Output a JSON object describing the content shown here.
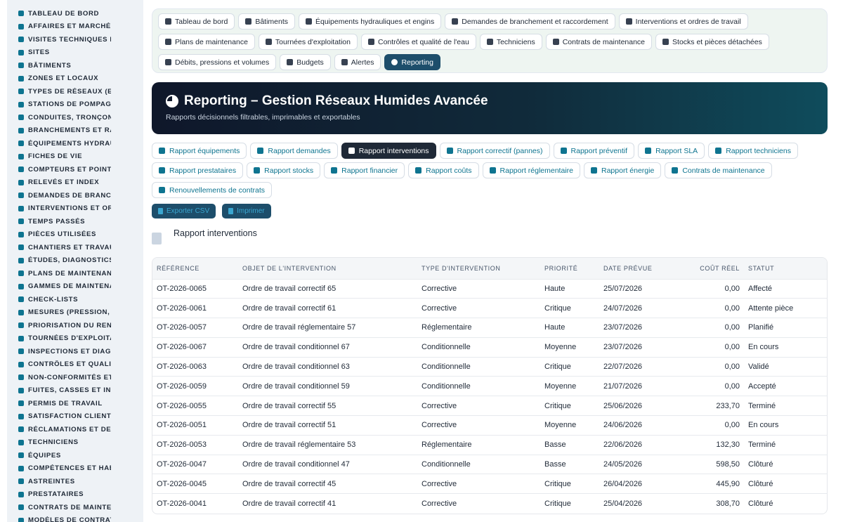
{
  "sidebar": {
    "items": [
      {
        "label": "TABLEAU DE BORD",
        "icon": "gauge-icon"
      },
      {
        "label": "AFFAIRES ET MARCHÉS",
        "icon": "target-icon"
      },
      {
        "label": "VISITES TECHNIQUES ET",
        "icon": "clipboard-icon"
      },
      {
        "label": "SITES",
        "icon": "map-pin-icon"
      },
      {
        "label": "BÂTIMENTS",
        "icon": "building-icon"
      },
      {
        "label": "ZONES ET LOCAUX",
        "icon": "layers-icon"
      },
      {
        "label": "TYPES DE RÉSEAUX (EAU",
        "icon": "network-icon"
      },
      {
        "label": "STATIONS DE POMPAGE I",
        "icon": "station-icon"
      },
      {
        "label": "CONDUITES, TRONÇONS",
        "icon": "pipe-icon"
      },
      {
        "label": "BRANCHEMENTS ET RAC",
        "icon": "branch-icon"
      },
      {
        "label": "ÉQUIPEMENTS HYDRAUL",
        "icon": "gears-icon"
      },
      {
        "label": "FICHES DE VIE",
        "icon": "file-icon"
      },
      {
        "label": "COMPTEURS ET POINTS I",
        "icon": "meter-icon"
      },
      {
        "label": "RELEVÉS ET INDEX",
        "icon": "list-icon"
      },
      {
        "label": "DEMANDES DE BRANCHE",
        "icon": "question-icon"
      },
      {
        "label": "INTERVENTIONS ET ORDI",
        "icon": "clipboard-check-icon"
      },
      {
        "label": "TEMPS PASSÉS",
        "icon": "clock-icon"
      },
      {
        "label": "PIÈCES UTILISÉES",
        "icon": "box-icon"
      },
      {
        "label": "CHANTIERS ET TRAVAUX",
        "icon": "hammer-icon"
      },
      {
        "label": "ÉTUDES, DIAGNOSTICS E",
        "icon": "search-icon"
      },
      {
        "label": "PLANS DE MAINTENANCE",
        "icon": "calendar-icon"
      },
      {
        "label": "GAMMES DE MAINTENAN",
        "icon": "list-check-icon"
      },
      {
        "label": "CHECK-LISTS",
        "icon": "checklist-icon"
      },
      {
        "label": "MESURES (PRESSION, DÉ",
        "icon": "ruler-icon"
      },
      {
        "label": "PRIORISATION DU RENOU",
        "icon": "sort-icon"
      },
      {
        "label": "TOURNÉES D'EXPLOITATI",
        "icon": "route-icon"
      },
      {
        "label": "INSPECTIONS ET DIAGNC",
        "icon": "magnifier-icon"
      },
      {
        "label": "CONTRÔLES ET QUALITÉ",
        "icon": "flask-icon"
      },
      {
        "label": "NON-CONFORMITÉS ET A",
        "icon": "alert-icon"
      },
      {
        "label": "FUITES, CASSES ET INCI",
        "icon": "warning-icon"
      },
      {
        "label": "PERMIS DE TRAVAIL",
        "icon": "permit-icon"
      },
      {
        "label": "SATISFACTION CLIENT",
        "icon": "smile-icon"
      },
      {
        "label": "RÉCLAMATIONS ET DEMA",
        "icon": "comment-icon"
      },
      {
        "label": "TECHNICIENS",
        "icon": "helmet-icon"
      },
      {
        "label": "ÉQUIPES",
        "icon": "users-icon"
      },
      {
        "label": "COMPÉTENCES ET HABIL",
        "icon": "graduation-icon"
      },
      {
        "label": "ASTREINTES",
        "icon": "phone-icon"
      },
      {
        "label": "PRESTATAIRES",
        "icon": "handshake-icon"
      },
      {
        "label": "CONTRATS DE MAINTENA",
        "icon": "contract-icon"
      },
      {
        "label": "MODÈLES DE CONTRATS",
        "icon": "template-icon"
      }
    ]
  },
  "topnav": {
    "items": [
      {
        "label": "Tableau de bord",
        "icon": "gauge-icon",
        "active": false
      },
      {
        "label": "Bâtiments",
        "icon": "building-icon",
        "active": false
      },
      {
        "label": "Équipements hydrauliques et engins",
        "icon": "gears-icon",
        "active": false
      },
      {
        "label": "Demandes de branchement et raccordement",
        "icon": "question-icon",
        "active": false
      },
      {
        "label": "Interventions et ordres de travail",
        "icon": "clipboard-check-icon",
        "active": false
      },
      {
        "label": "Plans de maintenance",
        "icon": "calendar-icon",
        "active": false
      },
      {
        "label": "Tournées d'exploitation",
        "icon": "route-icon",
        "active": false
      },
      {
        "label": "Contrôles et qualité de l'eau",
        "icon": "flask-icon",
        "active": false
      },
      {
        "label": "Techniciens",
        "icon": "helmet-icon",
        "active": false
      },
      {
        "label": "Contrats de maintenance",
        "icon": "contract-icon",
        "active": false
      },
      {
        "label": "Stocks et pièces détachées",
        "icon": "network-icon",
        "active": false
      },
      {
        "label": "Débits, pressions et volumes",
        "icon": "bolt-icon",
        "active": false
      },
      {
        "label": "Budgets",
        "icon": "money-icon",
        "active": false
      },
      {
        "label": "Alertes",
        "icon": "bell-icon",
        "active": false
      },
      {
        "label": "Reporting",
        "icon": "pie-chart-icon",
        "active": true
      }
    ]
  },
  "hero": {
    "title": "Reporting – Gestion Réseaux Humides Avancée",
    "subtitle": "Rapports décisionnels filtrables, imprimables et exportables"
  },
  "reports": {
    "items": [
      {
        "label": "Rapport équipements",
        "icon": "gears-icon",
        "active": false
      },
      {
        "label": "Rapport demandes",
        "icon": "question-icon",
        "active": false
      },
      {
        "label": "Rapport interventions",
        "icon": "clipboard-check-icon",
        "active": true
      },
      {
        "label": "Rapport correctif (pannes)",
        "icon": "tools-icon",
        "active": false
      },
      {
        "label": "Rapport préventif",
        "icon": "calendar-icon",
        "active": false
      },
      {
        "label": "Rapport SLA",
        "icon": "stopwatch-icon",
        "active": false
      },
      {
        "label": "Rapport techniciens",
        "icon": "helmet-icon",
        "active": false
      },
      {
        "label": "Rapport prestataires",
        "icon": "handshake-icon",
        "active": false
      },
      {
        "label": "Rapport stocks",
        "icon": "network-icon",
        "active": false
      },
      {
        "label": "Rapport financier",
        "icon": "money-icon",
        "active": false
      },
      {
        "label": "Rapport coûts",
        "icon": "coins-icon",
        "active": false
      },
      {
        "label": "Rapport réglementaire",
        "icon": "clipboard-check-icon",
        "active": false
      },
      {
        "label": "Rapport énergie",
        "icon": "bolt-icon",
        "active": false
      },
      {
        "label": "Contrats de maintenance",
        "icon": "contract-icon",
        "active": false
      },
      {
        "label": "Renouvellements de contrats",
        "icon": "refresh-icon",
        "active": false
      }
    ]
  },
  "actions": {
    "export_label": "Exporter CSV",
    "print_label": "Imprimer"
  },
  "report": {
    "title": "Rapport interventions"
  },
  "table": {
    "headers": [
      "Référence",
      "Objet de l'intervention",
      "Type d'intervention",
      "Priorité",
      "Date prévue",
      "Coût réel",
      "Statut"
    ],
    "rows": [
      [
        "OT-2026-0065",
        "Ordre de travail correctif 65",
        "Corrective",
        "Haute",
        "25/07/2026",
        "0,00",
        "Affecté"
      ],
      [
        "OT-2026-0061",
        "Ordre de travail correctif 61",
        "Corrective",
        "Critique",
        "24/07/2026",
        "0,00",
        "Attente pièce"
      ],
      [
        "OT-2026-0057",
        "Ordre de travail réglementaire 57",
        "Réglementaire",
        "Haute",
        "23/07/2026",
        "0,00",
        "Planifié"
      ],
      [
        "OT-2026-0067",
        "Ordre de travail conditionnel 67",
        "Conditionnelle",
        "Moyenne",
        "23/07/2026",
        "0,00",
        "En cours"
      ],
      [
        "OT-2026-0063",
        "Ordre de travail conditionnel 63",
        "Conditionnelle",
        "Critique",
        "22/07/2026",
        "0,00",
        "Validé"
      ],
      [
        "OT-2026-0059",
        "Ordre de travail conditionnel 59",
        "Conditionnelle",
        "Moyenne",
        "21/07/2026",
        "0,00",
        "Accepté"
      ],
      [
        "OT-2026-0055",
        "Ordre de travail correctif 55",
        "Corrective",
        "Critique",
        "25/06/2026",
        "233,70",
        "Terminé"
      ],
      [
        "OT-2026-0051",
        "Ordre de travail correctif 51",
        "Corrective",
        "Moyenne",
        "24/06/2026",
        "0,00",
        "En cours"
      ],
      [
        "OT-2026-0053",
        "Ordre de travail réglementaire 53",
        "Réglementaire",
        "Basse",
        "22/06/2026",
        "132,30",
        "Terminé"
      ],
      [
        "OT-2026-0047",
        "Ordre de travail conditionnel 47",
        "Conditionnelle",
        "Basse",
        "24/05/2026",
        "598,50",
        "Clôturé"
      ],
      [
        "OT-2026-0045",
        "Ordre de travail correctif 45",
        "Corrective",
        "Critique",
        "26/04/2026",
        "445,90",
        "Clôturé"
      ],
      [
        "OT-2026-0041",
        "Ordre de travail correctif 41",
        "Corrective",
        "Critique",
        "25/04/2026",
        "308,70",
        "Clôturé"
      ]
    ]
  },
  "colors": {
    "accent": "#0e7490",
    "active_nav": "#1d4e6b",
    "active_report": "#1f2937",
    "hero_start": "#0f172a",
    "hero_end": "#0f4c5c"
  }
}
